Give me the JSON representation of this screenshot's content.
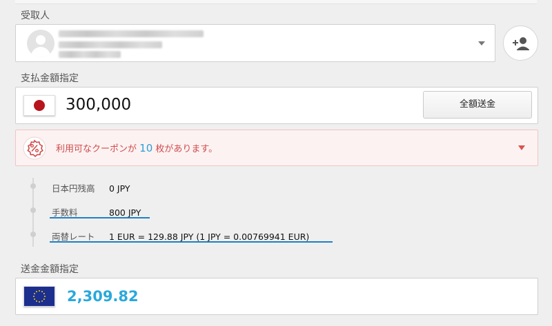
{
  "recipient": {
    "label": "受取人"
  },
  "payment": {
    "label": "支払金額指定",
    "amount": "300,000",
    "currency_flag": "japan-flag-icon",
    "all_button": "全額送金"
  },
  "coupon": {
    "prefix": "利用可なクーポンが",
    "count": "10",
    "suffix": "枚があります。"
  },
  "details": [
    {
      "key": "日本円残高",
      "value": "0 JPY"
    },
    {
      "key": "手数料",
      "value": "800 JPY"
    },
    {
      "key": "両替レート",
      "value": "1 EUR = 129.88 JPY (1 JPY = 0.00769941 EUR)"
    }
  ],
  "send": {
    "label": "送金金額指定",
    "amount": "2,309.82",
    "currency_flag": "eu-flag-icon"
  },
  "colors": {
    "accent_blue": "#2aa8dc",
    "coupon_red": "#cf4b4b",
    "underline_blue": "#1f7fc4"
  }
}
